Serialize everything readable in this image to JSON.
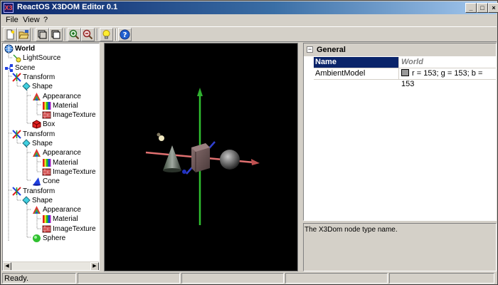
{
  "window": {
    "title": "ReactOS X3DOM Editor 0.1",
    "app_icon_glyph": "X3"
  },
  "title_buttons": {
    "minimize": "_",
    "maximize": "□",
    "close": "×"
  },
  "menu": {
    "items": [
      "File",
      "View",
      "?"
    ]
  },
  "toolbar": {
    "buttons": [
      "new-file-icon",
      "open-folder-icon",
      "view-mode-a-icon",
      "view-mode-b-icon",
      "zoom-in-icon",
      "zoom-out-icon",
      "light-bulb-icon",
      "help-icon"
    ]
  },
  "tree": {
    "nodes": [
      {
        "label": "World",
        "depth": 0,
        "icon": "globe-icon",
        "bold": true
      },
      {
        "label": "LightSource",
        "depth": 1,
        "icon": "light-icon"
      },
      {
        "label": "Scene",
        "depth": 0,
        "icon": "scene-icon"
      },
      {
        "label": "Transform",
        "depth": 1,
        "icon": "transform-icon"
      },
      {
        "label": "Shape",
        "depth": 2,
        "icon": "shape-icon"
      },
      {
        "label": "Appearance",
        "depth": 3,
        "icon": "appearance-icon"
      },
      {
        "label": "Material",
        "depth": 4,
        "icon": "material-icon"
      },
      {
        "label": "ImageTexture",
        "depth": 4,
        "icon": "texture-icon"
      },
      {
        "label": "Box",
        "depth": 3,
        "icon": "box-icon"
      },
      {
        "label": "Transform",
        "depth": 1,
        "icon": "transform-icon"
      },
      {
        "label": "Shape",
        "depth": 2,
        "icon": "shape-icon"
      },
      {
        "label": "Appearance",
        "depth": 3,
        "icon": "appearance-icon"
      },
      {
        "label": "Material",
        "depth": 4,
        "icon": "material-icon"
      },
      {
        "label": "ImageTexture",
        "depth": 4,
        "icon": "texture-icon"
      },
      {
        "label": "Cone",
        "depth": 3,
        "icon": "cone-icon"
      },
      {
        "label": "Transform",
        "depth": 1,
        "icon": "transform-icon"
      },
      {
        "label": "Shape",
        "depth": 2,
        "icon": "shape-icon"
      },
      {
        "label": "Appearance",
        "depth": 3,
        "icon": "appearance-icon"
      },
      {
        "label": "Material",
        "depth": 4,
        "icon": "material-icon"
      },
      {
        "label": "ImageTexture",
        "depth": 4,
        "icon": "texture-icon"
      },
      {
        "label": "Sphere",
        "depth": 3,
        "icon": "sphere-icon"
      }
    ]
  },
  "properties": {
    "category": "General",
    "category_toggle": "−",
    "rows": [
      {
        "name": "Name",
        "value": "World",
        "selected": true
      },
      {
        "name": "AmbientModel",
        "value": "r = 153; g = 153; b = 153",
        "swatch": "#999999"
      }
    ],
    "description": "The X3Dom node type name."
  },
  "status": {
    "text": "Ready."
  },
  "colors": {
    "title_start": "#0a246a",
    "title_end": "#a6caf0",
    "selection": "#0a246a",
    "viewport_bg": "#000000"
  }
}
